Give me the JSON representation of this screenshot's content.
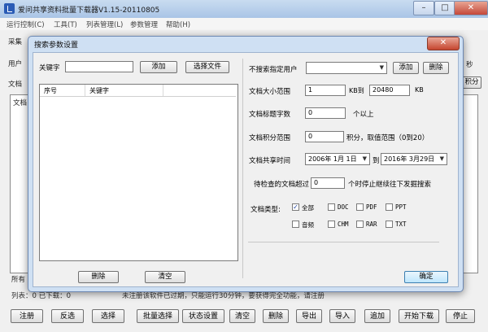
{
  "window": {
    "title": "爱问共享资料批量下载器V1.15-20110805",
    "min_glyph": "–",
    "max_glyph": "□",
    "close_glyph": "✕"
  },
  "menu": [
    "运行控制(C)",
    "工具(T)",
    "列表管理(L)",
    "参数管理",
    "帮助(H)"
  ],
  "main_peek": {
    "collect": "采集",
    "user": "用户",
    "doc_label": "文档",
    "list_col": "文档",
    "right_seconds": "秒",
    "right_points": "积分",
    "all_label": "所有",
    "status_left": "列表：0  已下载：0",
    "status_msg": "未注册该软件已过期，只能运行30分钟，要获得完全功能，请注册"
  },
  "bottom_buttons": [
    "注册",
    "反选",
    "选择",
    "批量选择",
    "状态设置",
    "清空",
    "删除",
    "导出",
    "导入",
    "追加",
    "开始下载",
    "停止"
  ],
  "dialog": {
    "title": "搜索参数设置",
    "close_glyph": "✕",
    "keyword_label": "关键字",
    "keyword_value": "",
    "add_button": "添加",
    "choose_file_button": "选择文件",
    "table_headers": [
      "序号",
      "关键字"
    ],
    "delete_button": "删除",
    "clear_button": "清空",
    "exclude_user_label": "不搜索指定用户",
    "exclude_user_value": "",
    "user_add_button": "添加",
    "user_delete_button": "删除",
    "size_label": "文档大小范围",
    "size_min": "1",
    "size_min_unit": "KB到",
    "size_max": "20480",
    "size_max_unit": "KB",
    "title_len_label": "文档标题字数",
    "title_len_value": "0",
    "title_len_suffix": "个以上",
    "points_label": "文档积分范围",
    "points_value": "0",
    "points_suffix": "积分，取值范围（0到20）",
    "share_time_label": "文档共享时间",
    "date_from": "2006年 1月 1日",
    "date_to_label": "到",
    "date_to": "2016年 3月29日",
    "stop_label": "待检查的文档超过",
    "stop_value": "0",
    "stop_suffix": "个时停止继续往下发掘搜索",
    "doctype_label": "文档类型:",
    "types": [
      {
        "name": "全部",
        "checked": true
      },
      {
        "name": "DOC",
        "checked": false
      },
      {
        "name": "PDF",
        "checked": false
      },
      {
        "name": "PPT",
        "checked": false
      },
      {
        "name": "音频",
        "checked": false
      },
      {
        "name": "CHM",
        "checked": false
      },
      {
        "name": "RAR",
        "checked": false
      },
      {
        "name": "TXT",
        "checked": false
      }
    ],
    "ok_button": "确定",
    "check_glyph": "✓"
  }
}
